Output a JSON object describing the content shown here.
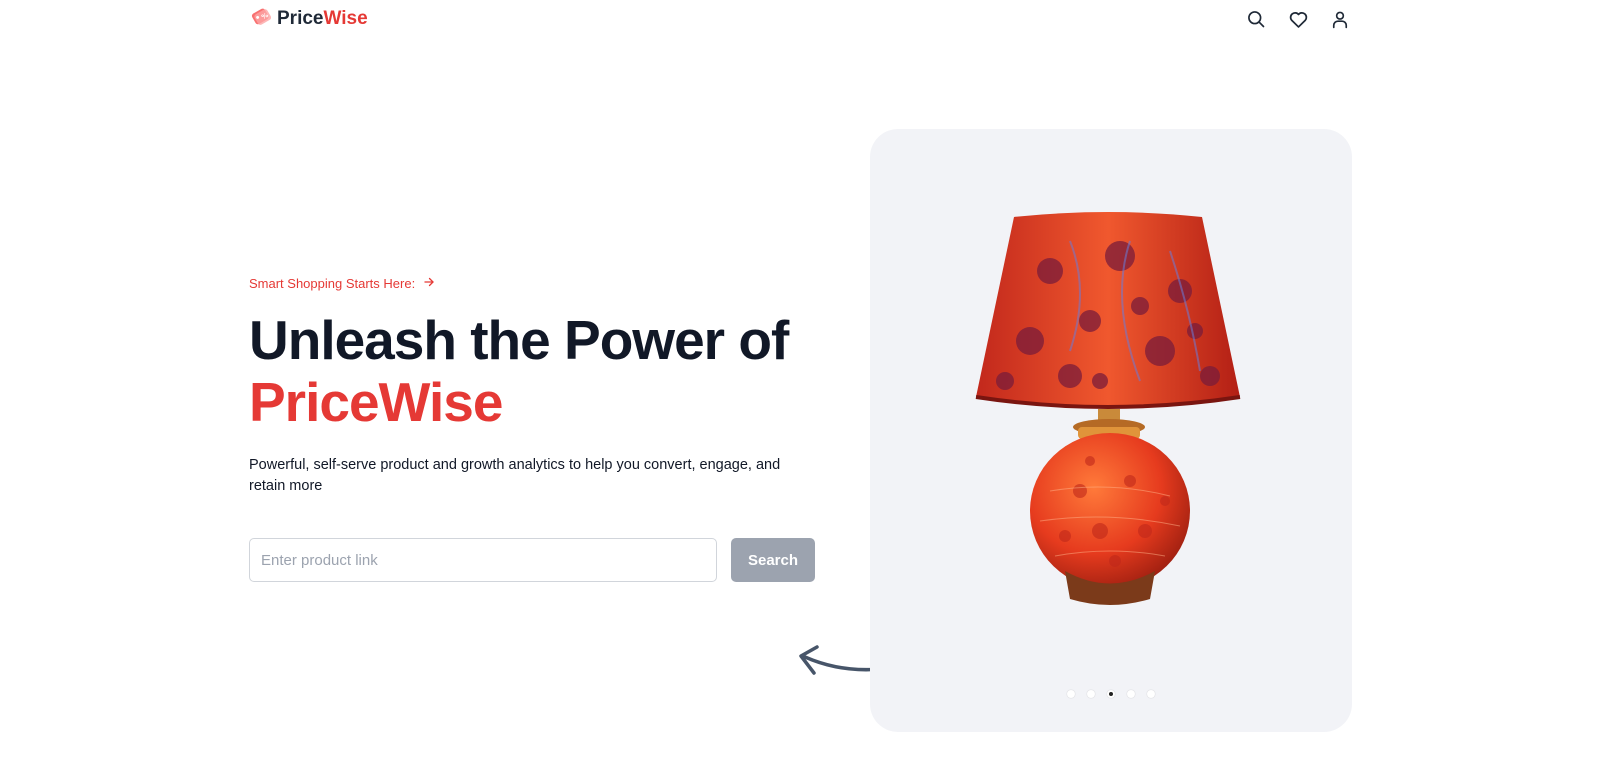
{
  "brand": {
    "part1": "Price",
    "part2": "Wise",
    "icon": "price-tag-icon",
    "accent_color": "#e53935"
  },
  "nav": {
    "icons": [
      "search-icon",
      "heart-icon",
      "user-icon"
    ]
  },
  "hero": {
    "tagline": "Smart Shopping Starts Here:",
    "headline_line1": "Unleash the Power of",
    "headline_line2": "PriceWise",
    "subtext": "Powerful, self-serve product and growth analytics to help you convert, engage, and retain more"
  },
  "search": {
    "placeholder": "Enter product link",
    "value": "",
    "button_label": "Search",
    "button_color": "#9ca3af"
  },
  "carousel": {
    "slide_count": 5,
    "active_index": 2,
    "current_product": "lamp"
  }
}
